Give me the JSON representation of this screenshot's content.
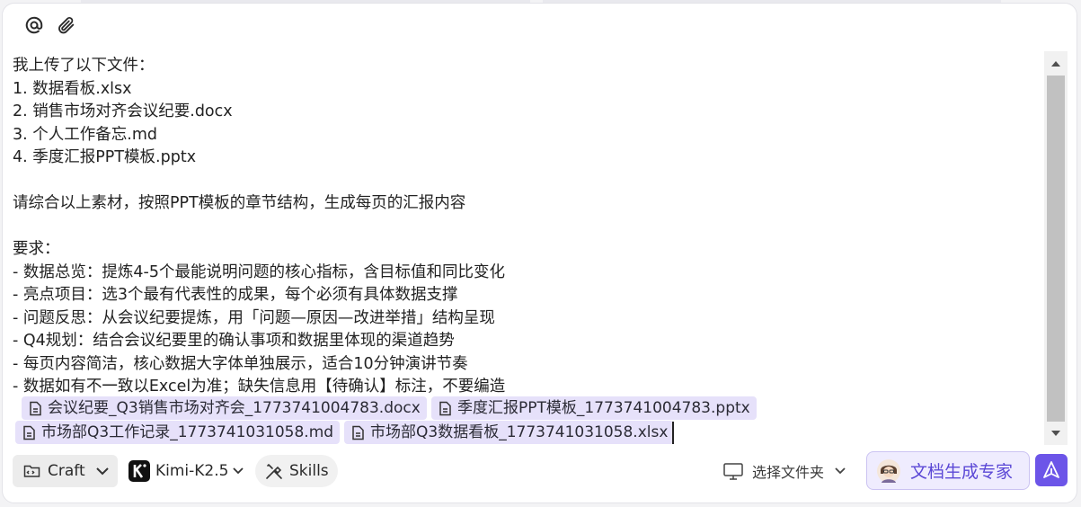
{
  "composer": {
    "lines": [
      "我上传了以下文件：",
      "1. 数据看板.xlsx",
      "2. 销售市场对齐会议纪要.docx",
      "3. 个人工作备忘.md",
      "4. 季度汇报PPT模板.pptx",
      "",
      "请综合以上素材，按照PPT模板的章节结构，生成每页的汇报内容",
      "",
      "要求：",
      "- 数据总览：提炼4-5个最能说明问题的核心指标，含目标值和同比变化",
      "- 亮点项目：选3个最有代表性的成果，每个必须有具体数据支撑",
      "- 问题反思：从会议纪要提炼，用「问题—原因—改进举措」结构呈现",
      "- Q4规划：结合会议纪要里的确认事项和数据里体现的渠道趋势",
      "- 每页内容简洁，核心数据大字体单独展示，适合10分钟演讲节奏",
      "- 数据如有不一致以Excel为准；缺失信息用【待确认】标注，不要编造"
    ],
    "attachments": [
      "会议纪要_Q3销售市场对齐会_1773741004783.docx",
      "季度汇报PPT模板_1773741004783.pptx",
      "市场部Q3工作记录_1773741031058.md",
      "市场部Q3数据看板_1773741031058.xlsx"
    ]
  },
  "toolbar": {
    "mode_label": "Craft",
    "model_label": "Kimi-K2.5",
    "skills_label": "Skills",
    "folder_label": "选择文件夹",
    "expert_label": "文档生成专家"
  },
  "colors": {
    "accent": "#6c55e8",
    "chip_bg": "#e6e1fa",
    "expert_text": "#5b48d6"
  },
  "icons": {
    "mention": "at-icon",
    "attach": "paperclip-icon",
    "file": "file-icon",
    "craft": "folder-code-icon",
    "model": "kimi-logo-icon",
    "skills": "tools-icon",
    "folder": "monitor-icon",
    "expert": "expert-avatar-icon",
    "send": "send-icon"
  }
}
